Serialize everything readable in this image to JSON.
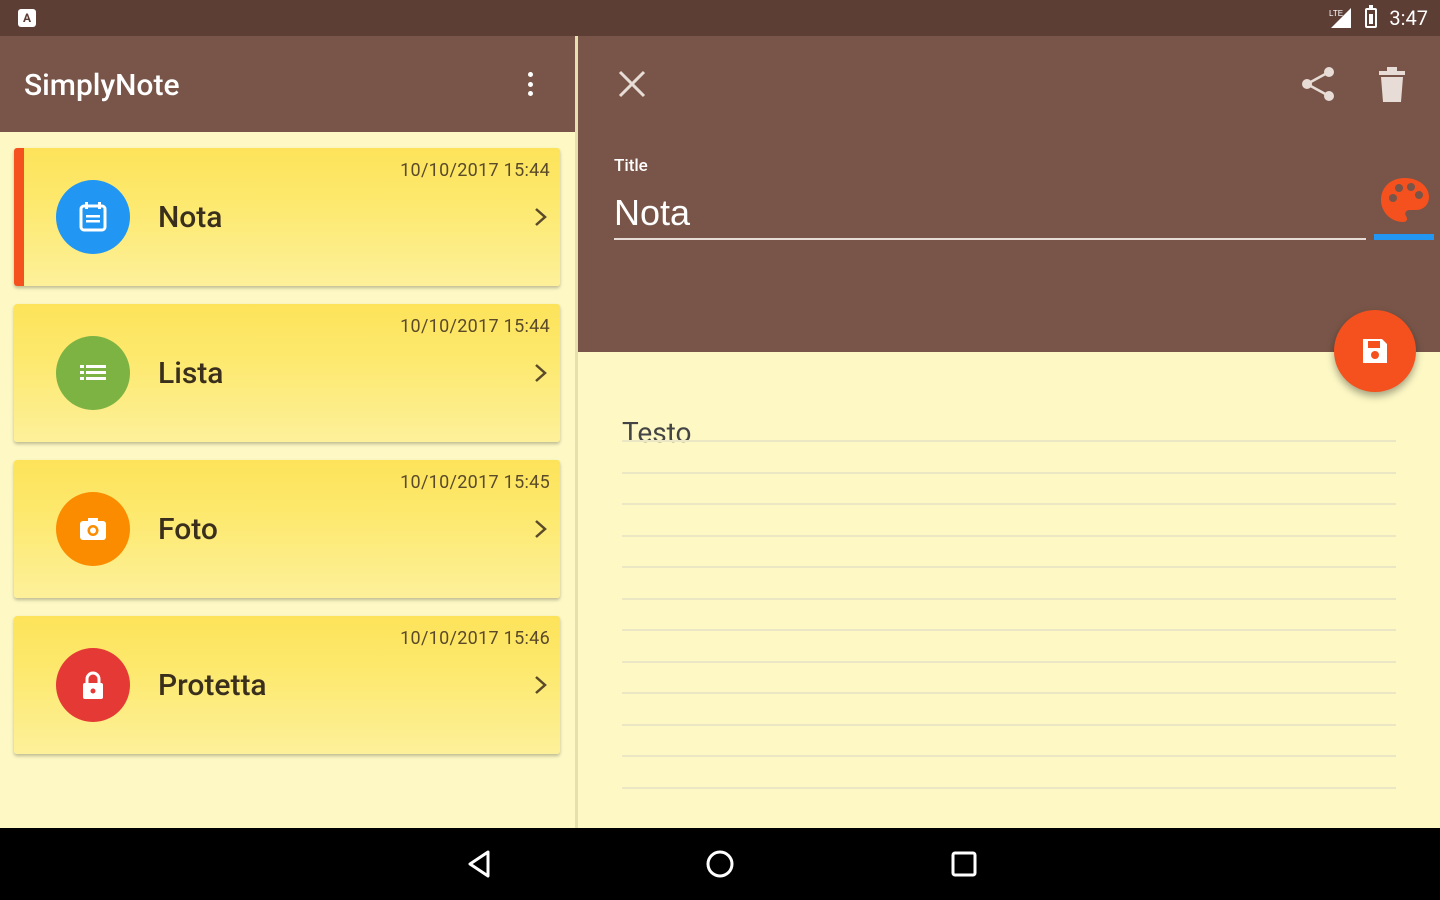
{
  "status_bar": {
    "time": "3:47",
    "notification_icon": "android-notification-icon"
  },
  "app": {
    "title": "SimplyNote"
  },
  "notes": [
    {
      "label": "Nota",
      "date": "10/10/2017 15:44",
      "icon": "note-icon",
      "color": "#2196f3",
      "active": true
    },
    {
      "label": "Lista",
      "date": "10/10/2017 15:44",
      "icon": "list-icon",
      "color": "#7cb342",
      "active": false
    },
    {
      "label": "Foto",
      "date": "10/10/2017 15:45",
      "icon": "camera-icon",
      "color": "#fb8c00",
      "active": false
    },
    {
      "label": "Protetta",
      "date": "10/10/2017 15:46",
      "icon": "lock-icon",
      "color": "#e53935",
      "active": false
    }
  ],
  "editor": {
    "title_label": "Title",
    "title_value": "Nota",
    "body_placeholder": "Testo"
  },
  "colors": {
    "brown_dark": "#5c3e35",
    "brown": "#785548",
    "note_yellow": "#fdf8c4",
    "accent_orange": "#f4511e",
    "accent_blue": "#2196f3"
  }
}
